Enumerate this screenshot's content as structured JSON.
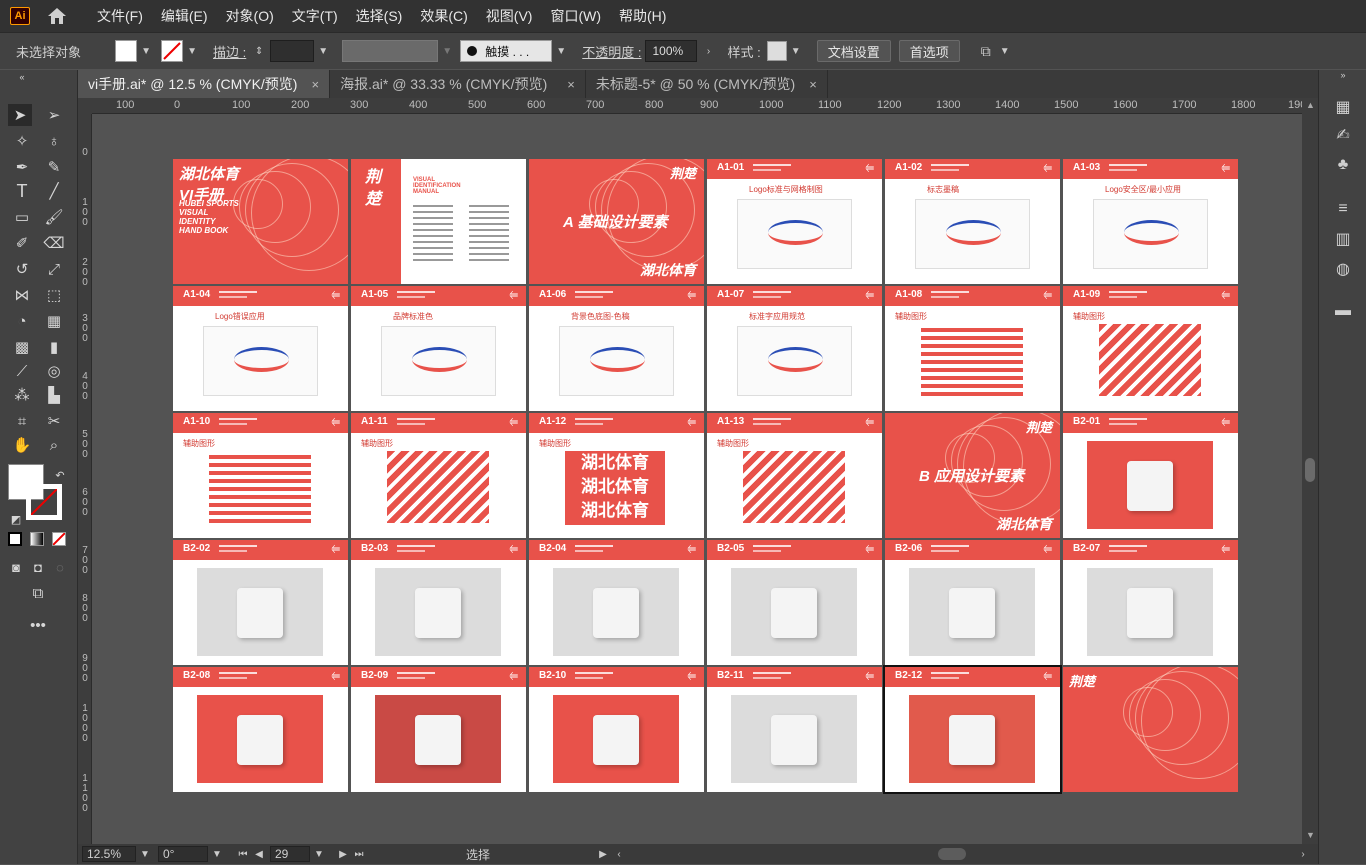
{
  "app": {
    "logo": "Ai",
    "home": "home-icon"
  },
  "menu": [
    "文件(F)",
    "编辑(E)",
    "对象(O)",
    "文字(T)",
    "选择(S)",
    "效果(C)",
    "视图(V)",
    "窗口(W)",
    "帮助(H)"
  ],
  "control": {
    "selection": "未选择对象",
    "stroke_label": "描边 :",
    "brush": "触摸 . . .",
    "opacity_label": "不透明度 :",
    "opacity_value": "100%",
    "style_label": "样式 :",
    "doc_setup": "文档设置",
    "prefs": "首选项"
  },
  "tabs": [
    {
      "label": "vi手册.ai* @ 12.5 % (CMYK/预览)",
      "close": "×"
    },
    {
      "label": "海报.ai* @ 33.33 % (CMYK/预览)",
      "close": "×"
    },
    {
      "label": "未标题-5* @ 50 % (CMYK/预览)",
      "close": "×"
    }
  ],
  "ruler_h": [
    "100",
    "0",
    "100",
    "200",
    "300",
    "400",
    "500",
    "600",
    "700",
    "800",
    "900",
    "1000",
    "1100",
    "1200",
    "1300",
    "1400",
    "1500",
    "1600",
    "1700",
    "1800",
    "190"
  ],
  "ruler_v": [
    "0",
    "1 0 0",
    "2 0 0",
    "3 0 0",
    "4 0 0",
    "5 0 0",
    "6 0 0",
    "7 0 0",
    "8 0 0",
    "9 0 0",
    "1 0 0 0",
    "1 1 0 0"
  ],
  "status": {
    "zoom": "12.5%",
    "rotate": "0°",
    "page": "29",
    "mode": "选择"
  },
  "boards": [
    {
      "code": "",
      "title": "湖北体育\nVI手册",
      "sub": "HUBEI SPORTS VISUAL IDENTITY HAND BOOK",
      "cover": true
    },
    {
      "code": "",
      "title": "荆楚",
      "sub": "VISUAL IDENTIFICATION MANUAL",
      "cover": false
    },
    {
      "code": "",
      "title": "A 基础设计要素",
      "sub": "湖北体育",
      "cover": true
    },
    {
      "code": "A1-01",
      "sub": "Logo标准与网格制图"
    },
    {
      "code": "A1-02",
      "sub": "标志墨稿"
    },
    {
      "code": "A1-03",
      "sub": "Logo安全区/最小应用"
    },
    {
      "code": "A1-04",
      "sub": "Logo错误应用"
    },
    {
      "code": "A1-05",
      "sub": "品牌标准色"
    },
    {
      "code": "A1-06",
      "sub": "背景色底图-色稿"
    },
    {
      "code": "A1-07",
      "sub": "标准字应用规范"
    },
    {
      "code": "A1-08",
      "sub": "辅助图形"
    },
    {
      "code": "A1-09",
      "sub": "辅助图形"
    },
    {
      "code": "A1-10",
      "sub": "辅助图形"
    },
    {
      "code": "A1-11",
      "sub": "辅助图形"
    },
    {
      "code": "A1-12",
      "sub": "辅助图形"
    },
    {
      "code": "A1-13",
      "sub": "辅助图形"
    },
    {
      "code": "",
      "title": "B 应用设计要素",
      "sub": "湖北体育",
      "cover": true
    },
    {
      "code": "B2-01",
      "sub": ""
    },
    {
      "code": "B2-02",
      "sub": ""
    },
    {
      "code": "B2-03",
      "sub": ""
    },
    {
      "code": "B2-04",
      "sub": ""
    },
    {
      "code": "B2-05",
      "sub": ""
    },
    {
      "code": "B2-06",
      "sub": ""
    },
    {
      "code": "B2-07",
      "sub": ""
    },
    {
      "code": "B2-08",
      "sub": ""
    },
    {
      "code": "B2-09",
      "sub": ""
    },
    {
      "code": "B2-10",
      "sub": ""
    },
    {
      "code": "B2-11",
      "sub": ""
    },
    {
      "code": "B2-12",
      "sub": ""
    },
    {
      "code": "",
      "title": "荆楚",
      "sub": "",
      "cover": true
    }
  ],
  "text": {
    "pattern_word": "湖北体育",
    "brand_mark": "荆楚"
  }
}
